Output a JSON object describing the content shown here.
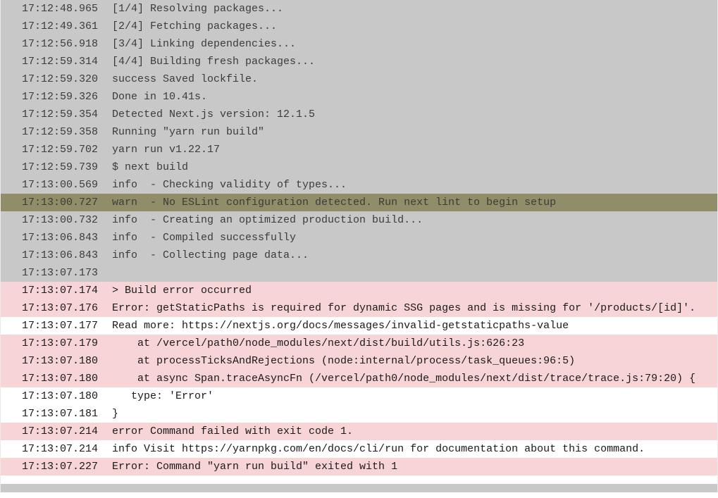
{
  "colors": {
    "info_bg": "#ffffff",
    "warn_bg": "#a9a167",
    "error_bg": "#f7d4d6",
    "dim_overlay": "rgba(110,110,110,0.38)"
  },
  "dim_rows": 16,
  "log": [
    {
      "ts": "17:12:48.965",
      "level": "info",
      "msg": "[1/4] Resolving packages..."
    },
    {
      "ts": "17:12:49.361",
      "level": "info",
      "msg": "[2/4] Fetching packages..."
    },
    {
      "ts": "17:12:56.918",
      "level": "info",
      "msg": "[3/4] Linking dependencies..."
    },
    {
      "ts": "17:12:59.314",
      "level": "info",
      "msg": "[4/4] Building fresh packages..."
    },
    {
      "ts": "17:12:59.320",
      "level": "info",
      "msg": "success Saved lockfile."
    },
    {
      "ts": "17:12:59.326",
      "level": "info",
      "msg": "Done in 10.41s."
    },
    {
      "ts": "17:12:59.354",
      "level": "info",
      "msg": "Detected Next.js version: 12.1.5"
    },
    {
      "ts": "17:12:59.358",
      "level": "info",
      "msg": "Running \"yarn run build\""
    },
    {
      "ts": "17:12:59.702",
      "level": "info",
      "msg": "yarn run v1.22.17"
    },
    {
      "ts": "17:12:59.739",
      "level": "info",
      "msg": "$ next build"
    },
    {
      "ts": "17:13:00.569",
      "level": "info",
      "msg": "info  - Checking validity of types..."
    },
    {
      "ts": "17:13:00.727",
      "level": "warn",
      "msg": "warn  - No ESLint configuration detected. Run next lint to begin setup"
    },
    {
      "ts": "17:13:00.732",
      "level": "info",
      "msg": "info  - Creating an optimized production build..."
    },
    {
      "ts": "17:13:06.843",
      "level": "info",
      "msg": "info  - Compiled successfully"
    },
    {
      "ts": "17:13:06.843",
      "level": "info",
      "msg": "info  - Collecting page data..."
    },
    {
      "ts": "17:13:07.173",
      "level": "info",
      "msg": ""
    },
    {
      "ts": "17:13:07.174",
      "level": "error",
      "msg": "> Build error occurred"
    },
    {
      "ts": "17:13:07.176",
      "level": "error",
      "msg": "Error: getStaticPaths is required for dynamic SSG pages and is missing for '/products/[id]'."
    },
    {
      "ts": "17:13:07.177",
      "level": "info",
      "msg": "Read more: https://nextjs.org/docs/messages/invalid-getstaticpaths-value"
    },
    {
      "ts": "17:13:07.179",
      "level": "error",
      "msg": "    at /vercel/path0/node_modules/next/dist/build/utils.js:626:23"
    },
    {
      "ts": "17:13:07.180",
      "level": "error",
      "msg": "    at processTicksAndRejections (node:internal/process/task_queues:96:5)"
    },
    {
      "ts": "17:13:07.180",
      "level": "error",
      "msg": "    at async Span.traceAsyncFn (/vercel/path0/node_modules/next/dist/trace/trace.js:79:20) {"
    },
    {
      "ts": "17:13:07.180",
      "level": "info",
      "msg": "   type: 'Error'"
    },
    {
      "ts": "17:13:07.181",
      "level": "info",
      "msg": "}"
    },
    {
      "ts": "17:13:07.214",
      "level": "error",
      "msg": "error Command failed with exit code 1."
    },
    {
      "ts": "17:13:07.214",
      "level": "info",
      "msg": "info Visit https://yarnpkg.com/en/docs/cli/run for documentation about this command."
    },
    {
      "ts": "17:13:07.227",
      "level": "error",
      "msg": "Error: Command \"yarn run build\" exited with 1"
    }
  ]
}
